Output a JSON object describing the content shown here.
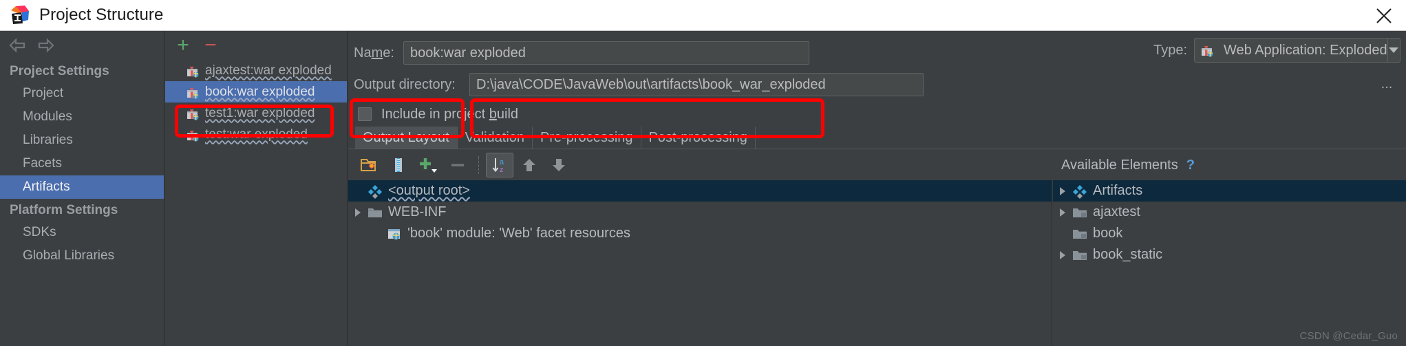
{
  "window": {
    "title": "Project Structure",
    "logo_icon": "intellij-idea-logo",
    "close_icon": "close-icon"
  },
  "nav": {
    "back_icon": "arrow-left-icon",
    "forward_icon": "arrow-right-icon"
  },
  "sidebar": {
    "groups": [
      {
        "label": "Project Settings",
        "items": [
          "Project",
          "Modules",
          "Libraries",
          "Facets",
          "Artifacts"
        ]
      },
      {
        "label": "Platform Settings",
        "items": [
          "SDKs",
          "Global Libraries"
        ]
      }
    ],
    "selected": "Artifacts"
  },
  "artifacts_panel": {
    "add_icon": "plus-icon",
    "remove_icon": "minus-icon",
    "items": [
      {
        "label": "ajaxtest:war exploded",
        "icon": "artifact-war-icon",
        "selected": false
      },
      {
        "label": "book:war exploded",
        "icon": "artifact-war-icon",
        "selected": true
      },
      {
        "label": "test1:war exploded",
        "icon": "artifact-war-icon",
        "selected": false
      },
      {
        "label": "test:war exploded",
        "icon": "artifact-war-icon",
        "selected": false
      }
    ]
  },
  "detail": {
    "name_label": "Name:",
    "name_label_mnemonic": "m",
    "name_value": "book:war exploded",
    "type_label": "Type:",
    "type_value": "Web Application: Exploded",
    "type_icon": "artifact-war-icon",
    "type_dropdown_icon": "chevron-down-icon",
    "output_directory_label": "Output directory:",
    "output_directory_value": "D:\\java\\CODE\\JavaWeb\\out\\artifacts\\book_war_exploded",
    "browse_label": "...",
    "include_in_build_label": "Include in project build",
    "include_in_build_mnemonic": "b",
    "include_in_build_checked": false,
    "tabs": [
      {
        "label": "Output Layout",
        "active": true
      },
      {
        "label": "Validation",
        "active": false
      },
      {
        "label": "Pre-processing",
        "active": false
      },
      {
        "label": "Post-processing",
        "active": false
      }
    ],
    "layout_toolbar": [
      {
        "name": "create-directory-icon",
        "enabled": true,
        "toggled": false
      },
      {
        "name": "create-archive-icon",
        "enabled": true,
        "toggled": false
      },
      {
        "name": "add-copy-of-icon",
        "enabled": true,
        "toggled": false
      },
      {
        "name": "remove-icon",
        "enabled": false,
        "toggled": false
      },
      {
        "name": "sort-alphabetically-icon",
        "enabled": true,
        "toggled": true
      },
      {
        "name": "move-up-icon",
        "enabled": true,
        "toggled": false
      },
      {
        "name": "move-down-icon",
        "enabled": true,
        "toggled": false
      }
    ],
    "output_tree": [
      {
        "label": "<output root>",
        "icon": "artifact-root-icon",
        "indent": 0,
        "expander": "none",
        "selected": true,
        "squiggly": true
      },
      {
        "label": "WEB-INF",
        "icon": "folder-icon",
        "indent": 0,
        "expander": "collapsed",
        "selected": false,
        "squiggly": false
      },
      {
        "label": "'book' module: 'Web' facet resources",
        "icon": "facet-resources-icon",
        "indent": 1,
        "expander": "none",
        "selected": false,
        "squiggly": false
      }
    ],
    "available_elements_title": "Available Elements",
    "available_help_icon": "help-icon",
    "available_tree": [
      {
        "label": "Artifacts",
        "icon": "artifact-root-icon",
        "indent": 0,
        "expander": "collapsed",
        "selected": true
      },
      {
        "label": "ajaxtest",
        "icon": "module-icon",
        "indent": 0,
        "expander": "collapsed",
        "selected": false
      },
      {
        "label": "book",
        "icon": "module-icon",
        "indent": 0,
        "expander": "none",
        "selected": false
      },
      {
        "label": "book_static",
        "icon": "module-icon",
        "indent": 0,
        "expander": "collapsed",
        "selected": false
      }
    ]
  },
  "watermark": "CSDN @Cedar_Guo",
  "colors": {
    "window_bg": "#3c3f41",
    "titlebar_bg": "#ffffff",
    "selection_blue": "#4b6eaf",
    "tree_selection": "#0d293e",
    "annotation_red": "#fe0000",
    "accent_green": "#59a869",
    "accent_red": "#c75450",
    "link_blue": "#5a9bd8"
  }
}
